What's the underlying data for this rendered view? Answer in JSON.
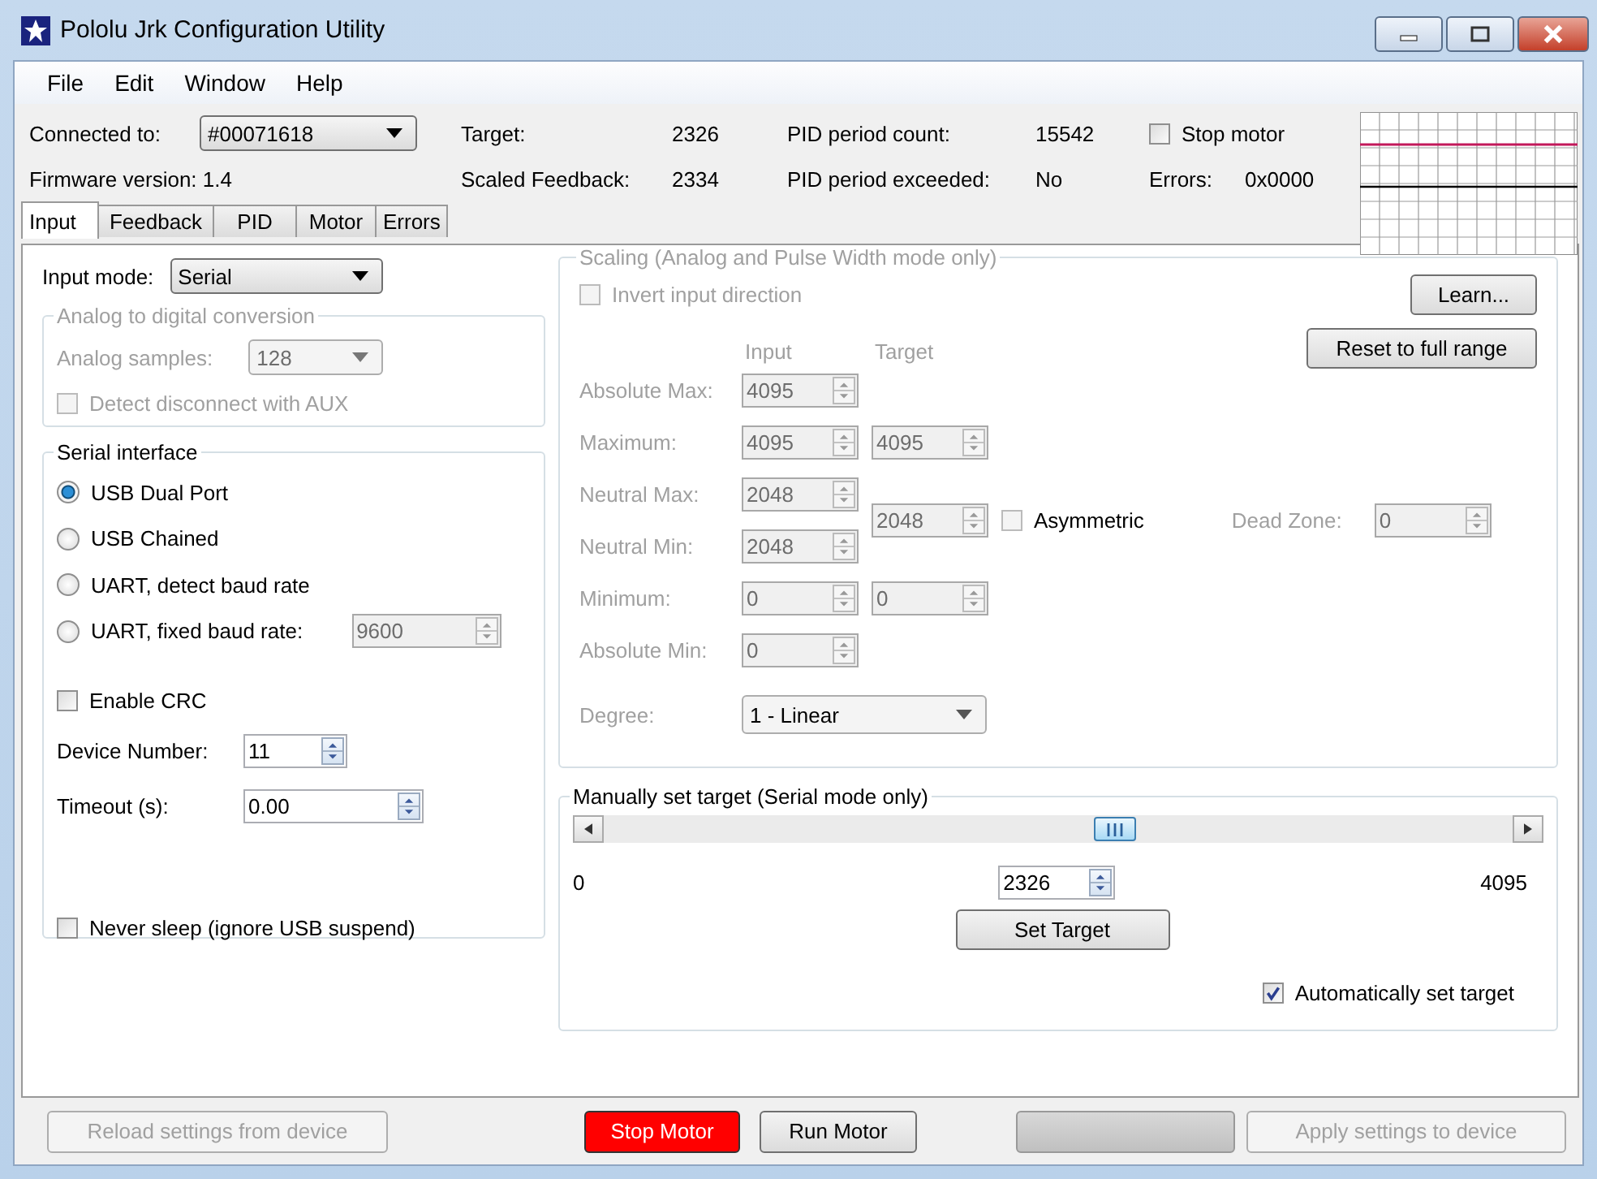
{
  "window": {
    "title": "Pololu Jrk Configuration Utility"
  },
  "menu": [
    "File",
    "Edit",
    "Window",
    "Help"
  ],
  "status": {
    "connected_label": "Connected to:",
    "device": "#00071618",
    "firmware": "Firmware version: 1.4",
    "readouts": [
      {
        "label": "Target:",
        "value": "2326"
      },
      {
        "label": "Scaled Feedback:",
        "value": "2334"
      },
      {
        "label": "PID period count:",
        "value": "15542"
      },
      {
        "label": "PID period exceeded:",
        "value": "No"
      }
    ],
    "stop_motor": {
      "label": "Stop motor",
      "checked": false
    },
    "errors": {
      "label": "Errors:",
      "value": "0x0000"
    }
  },
  "tabs": [
    {
      "label": "Input",
      "selected": true
    },
    {
      "label": "Feedback",
      "selected": false
    },
    {
      "label": "PID",
      "selected": false
    },
    {
      "label": "Motor",
      "selected": false
    },
    {
      "label": "Errors",
      "selected": false
    }
  ],
  "input_mode": {
    "label": "Input mode:",
    "value": "Serial"
  },
  "adc": {
    "title": "Analog to digital conversion",
    "disabled": true,
    "samples_label": "Analog samples:",
    "samples": "128",
    "detect": {
      "label": "Detect disconnect with AUX",
      "checked": false
    }
  },
  "serial": {
    "title": "Serial interface",
    "radios": [
      {
        "label": "USB Dual Port",
        "selected": true
      },
      {
        "label": "USB Chained",
        "selected": false
      },
      {
        "label": "UART, detect baud rate",
        "selected": false
      },
      {
        "label": "UART, fixed baud rate:",
        "selected": false
      }
    ],
    "baud": "9600",
    "crc": {
      "label": "Enable CRC",
      "checked": false
    },
    "device_number": {
      "label": "Device Number:",
      "value": "11"
    },
    "timeout": {
      "label": "Timeout (s):",
      "value": "0.00"
    },
    "never_sleep": {
      "label": "Never sleep (ignore USB suspend)",
      "checked": false
    }
  },
  "scaling": {
    "title": "Scaling (Analog and Pulse Width mode only)",
    "disabled": true,
    "invert": {
      "label": "Invert input direction",
      "checked": false
    },
    "learn": "Learn...",
    "reset": "Reset to full range",
    "headers": [
      "Input",
      "Target"
    ],
    "rows": [
      {
        "label": "Absolute Max:",
        "input": "4095"
      },
      {
        "label": "Maximum:",
        "input": "4095",
        "target": "4095"
      },
      {
        "label": "Neutral Max:",
        "input": "2048"
      },
      {
        "label": "Neutral Min:",
        "input": "2048"
      },
      {
        "label": "Minimum:",
        "input": "0",
        "target": "0"
      },
      {
        "label": "Absolute Min:",
        "input": "0"
      }
    ],
    "neutral_target": "2048",
    "asymmetric": {
      "label": "Asymmetric",
      "checked": false
    },
    "dead_zone": {
      "label": "Dead Zone:",
      "value": "0"
    },
    "degree": {
      "label": "Degree:",
      "value": "1 - Linear"
    }
  },
  "manual": {
    "title": "Manually set target (Serial mode only)",
    "level": 0.568,
    "min": "0",
    "max": "4095",
    "value": "2326",
    "set_button": "Set Target",
    "auto": {
      "label": "Automatically set target",
      "checked": true
    }
  },
  "bottom_buttons": [
    {
      "label": "Reload settings from device",
      "kind": "disabled"
    },
    {
      "label": "Stop Motor",
      "kind": "danger"
    },
    {
      "label": "Run Motor",
      "kind": "normal"
    },
    {
      "kind": "blank"
    },
    {
      "label": "Apply settings to device",
      "kind": "disabled"
    }
  ]
}
